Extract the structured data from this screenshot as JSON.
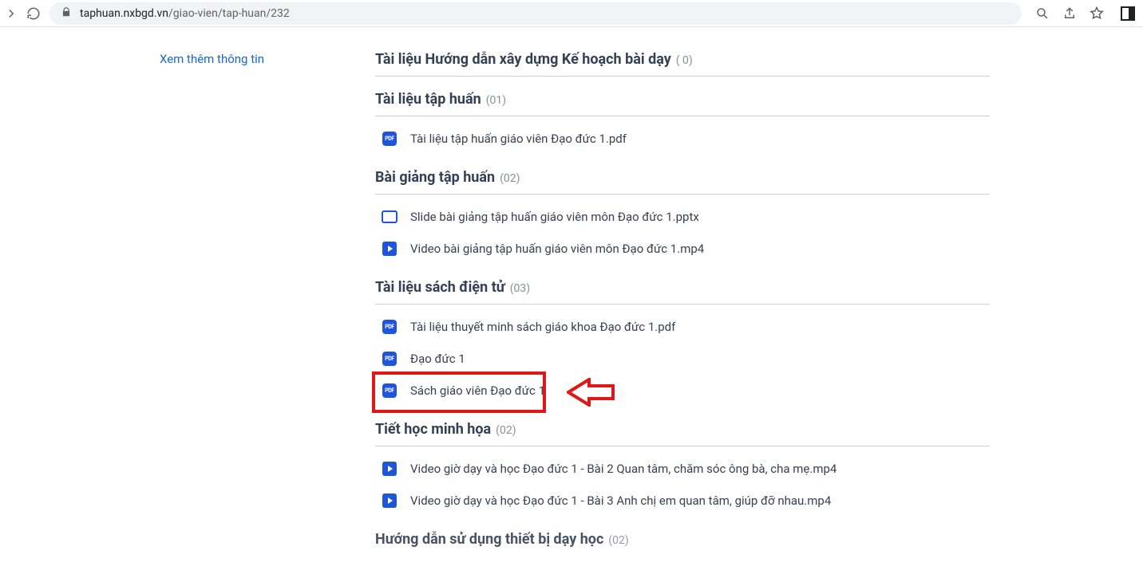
{
  "browser": {
    "url_host": "taphuan.nxbgd.vn",
    "url_path": "/giao-vien/tap-huan/232"
  },
  "sidebar": {
    "more_info": "Xem thêm thông tin"
  },
  "sections": [
    {
      "title": "Tài liệu Hướng dẫn xây dựng Kế hoạch bài dạy",
      "count": "( 0)",
      "items": []
    },
    {
      "title": "Tài liệu tập huấn",
      "count": "(01)",
      "items": [
        {
          "icon": "pdf",
          "label": "Tài liệu tập huấn giáo viên Đạo đức 1.pdf"
        }
      ]
    },
    {
      "title": "Bài giảng tập huấn",
      "count": "(02)",
      "items": [
        {
          "icon": "slide",
          "label": "Slide bài giảng tập huấn giáo viên môn Đạo đức 1.pptx"
        },
        {
          "icon": "video",
          "label": "Video bài giảng tập huấn giáo viên môn Đạo đức 1.mp4"
        }
      ]
    },
    {
      "title": "Tài liệu sách điện tử",
      "count": "(03)",
      "items": [
        {
          "icon": "pdf",
          "label": "Tài liệu thuyết minh sách giáo khoa Đạo đức 1.pdf"
        },
        {
          "icon": "pdf",
          "label": "Đạo đức 1"
        },
        {
          "icon": "pdf",
          "label": "Sách giáo viên Đạo đức 1",
          "highlight": true
        }
      ]
    },
    {
      "title": "Tiết học minh họa",
      "count": "(02)",
      "items": [
        {
          "icon": "video",
          "label": "Video giờ dạy và học Đạo đức 1 - Bài 2 Quan tâm, chăm sóc ông bà, cha mẹ.mp4"
        },
        {
          "icon": "video",
          "label": "Video giờ dạy và học Đạo đức 1 - Bài 3 Anh chị em quan tâm, giúp đỡ nhau.mp4"
        }
      ]
    },
    {
      "title": "Hướng dẫn sử dụng thiết bị dạy học",
      "count": "(02)",
      "items": []
    }
  ],
  "icon_text": {
    "pdf": "PDF"
  }
}
